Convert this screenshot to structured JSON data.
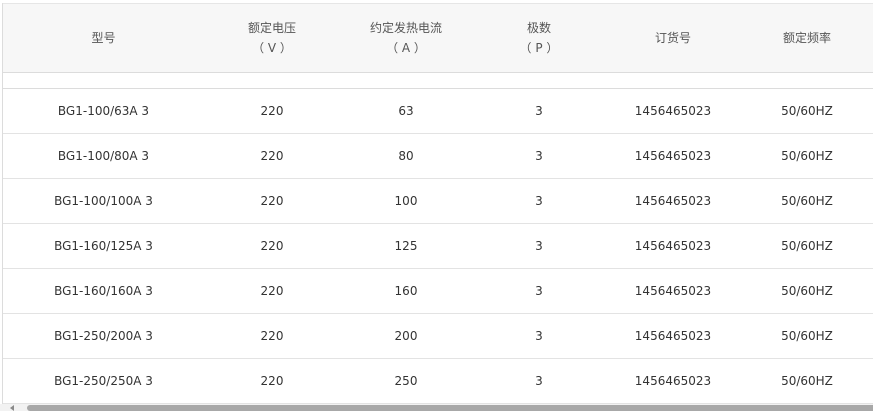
{
  "table": {
    "headers": [
      {
        "line1": "型号",
        "line2": ""
      },
      {
        "line1": "额定电压",
        "line2": "（ V ）"
      },
      {
        "line1": "约定发热电流",
        "line2": "（ A ）"
      },
      {
        "line1": "极数",
        "line2": "（ P ）"
      },
      {
        "line1": "订货号",
        "line2": ""
      },
      {
        "line1": "额定频率",
        "line2": ""
      }
    ],
    "rows": [
      {
        "model": "BG1-100/63A 3",
        "voltage": "220",
        "current": "63",
        "poles": "3",
        "order_no": "1456465023",
        "frequency": "50/60HZ"
      },
      {
        "model": "BG1-100/80A 3",
        "voltage": "220",
        "current": "80",
        "poles": "3",
        "order_no": "1456465023",
        "frequency": "50/60HZ"
      },
      {
        "model": "BG1-100/100A 3",
        "voltage": "220",
        "current": "100",
        "poles": "3",
        "order_no": "1456465023",
        "frequency": "50/60HZ"
      },
      {
        "model": "BG1-160/125A 3",
        "voltage": "220",
        "current": "125",
        "poles": "3",
        "order_no": "1456465023",
        "frequency": "50/60HZ"
      },
      {
        "model": "BG1-160/160A 3",
        "voltage": "220",
        "current": "160",
        "poles": "3",
        "order_no": "1456465023",
        "frequency": "50/60HZ"
      },
      {
        "model": "BG1-250/200A 3",
        "voltage": "220",
        "current": "200",
        "poles": "3",
        "order_no": "1456465023",
        "frequency": "50/60HZ"
      },
      {
        "model": "BG1-250/250A 3",
        "voltage": "220",
        "current": "250",
        "poles": "3",
        "order_no": "1456465023",
        "frequency": "50/60HZ"
      }
    ]
  },
  "scrollbar": {
    "icon": "chevron-left-icon"
  }
}
